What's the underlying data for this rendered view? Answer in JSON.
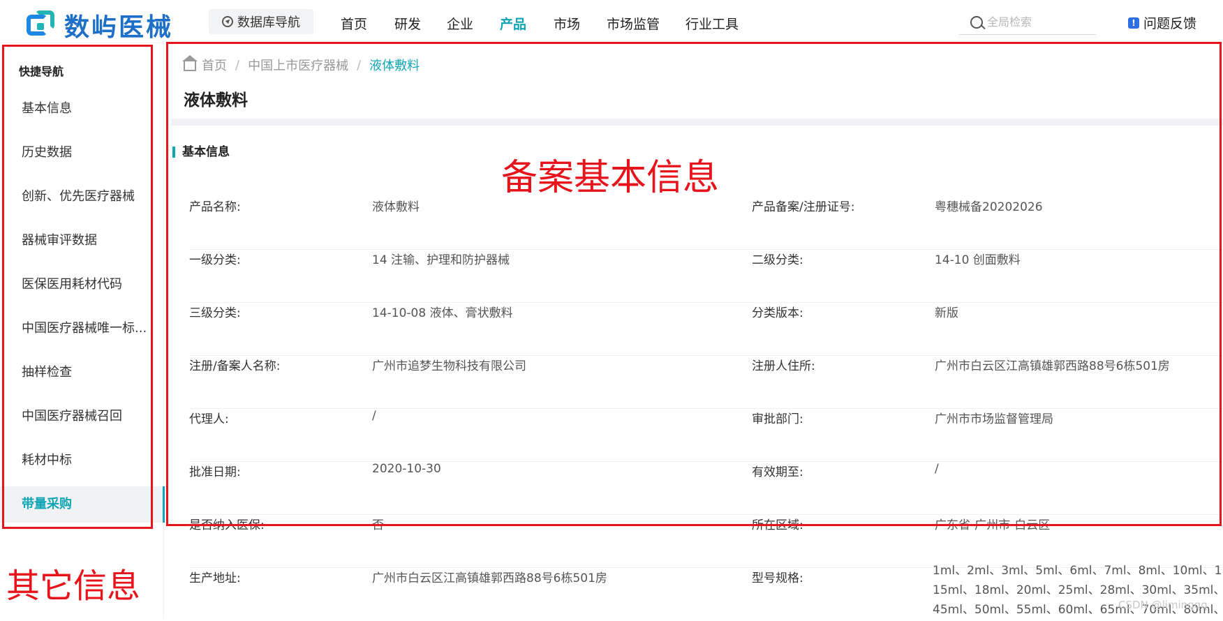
{
  "brand": {
    "logo_text": "数屿医械",
    "logo_icon": "logo-mark-icon"
  },
  "header": {
    "db_nav_label": "数据库导航",
    "menu": [
      {
        "label": "首页",
        "active": false
      },
      {
        "label": "研发",
        "active": false
      },
      {
        "label": "企业",
        "active": false
      },
      {
        "label": "产品",
        "active": true
      },
      {
        "label": "市场",
        "active": false
      },
      {
        "label": "市场监管",
        "active": false
      },
      {
        "label": "行业工具",
        "active": false
      }
    ],
    "search_placeholder": "全局检索",
    "feedback_label": "问题反馈"
  },
  "sidebar": {
    "title": "快捷导航",
    "items": [
      {
        "label": "基本信息"
      },
      {
        "label": "历史数据"
      },
      {
        "label": "创新、优先医疗器械"
      },
      {
        "label": "器械审评数据"
      },
      {
        "label": "医保医用耗材代码"
      },
      {
        "label": "中国医疗器械唯一标..."
      },
      {
        "label": "抽样检查"
      },
      {
        "label": "中国医疗器械召回"
      },
      {
        "label": "耗材中标"
      },
      {
        "label": "带量采购",
        "active": true
      }
    ]
  },
  "breadcrumb": {
    "home": "首页",
    "parent": "中国上市医疗器械",
    "current": "液体敷料",
    "separator": "/"
  },
  "page_title": "液体敷料",
  "section_title": "基本信息",
  "info": {
    "rows": [
      {
        "k1": "产品名称:",
        "v1": "液体敷料",
        "k2": "产品备案/注册证号:",
        "v2": "粤穗械备20202026"
      },
      {
        "k1": "一级分类:",
        "v1": "14 注输、护理和防护器械",
        "k2": "二级分类:",
        "v2": "14-10 创面敷料"
      },
      {
        "k1": "三级分类:",
        "v1": "14-10-08 液体、膏状敷料",
        "k2": "分类版本:",
        "v2": "新版"
      },
      {
        "k1": "注册/备案人名称:",
        "v1": "广州市追梦生物科技有限公司",
        "k2": "注册人住所:",
        "v2": "广州市白云区江高镇雄郭西路88号6栋501房"
      },
      {
        "k1": "代理人:",
        "v1": "/",
        "k2": "审批部门:",
        "v2": "广州市市场监督管理局"
      },
      {
        "k1": "批准日期:",
        "v1": "2020-10-30",
        "k2": "有效期至:",
        "v2": "/"
      },
      {
        "k1": "是否纳入医保:",
        "v1": "否",
        "k2": "所在区域:",
        "v2": "广东省-广州市-白云区"
      },
      {
        "k1": "生产地址:",
        "v1": "广州市白云区江高镇雄郭西路88号6栋501房",
        "k2": "型号规格:",
        "v2": ""
      }
    ],
    "spec_lines": [
      "1ml、2ml、3ml、5ml、6ml、7ml、8ml、10ml、1",
      "15ml、18ml、20ml、25ml、28ml、30ml、35ml、",
      "45ml、50ml、55ml、60ml、65ml、70ml、80ml、"
    ]
  },
  "annotations": {
    "left_label": "其它信息",
    "right_label": "备案基本信息",
    "color": "#e8141c"
  },
  "watermark": "CSDN @liminqqq",
  "colors": {
    "accent": "#10a5b5",
    "brand_blue": "#1e6fc7",
    "annotation_red": "#e8141c"
  }
}
